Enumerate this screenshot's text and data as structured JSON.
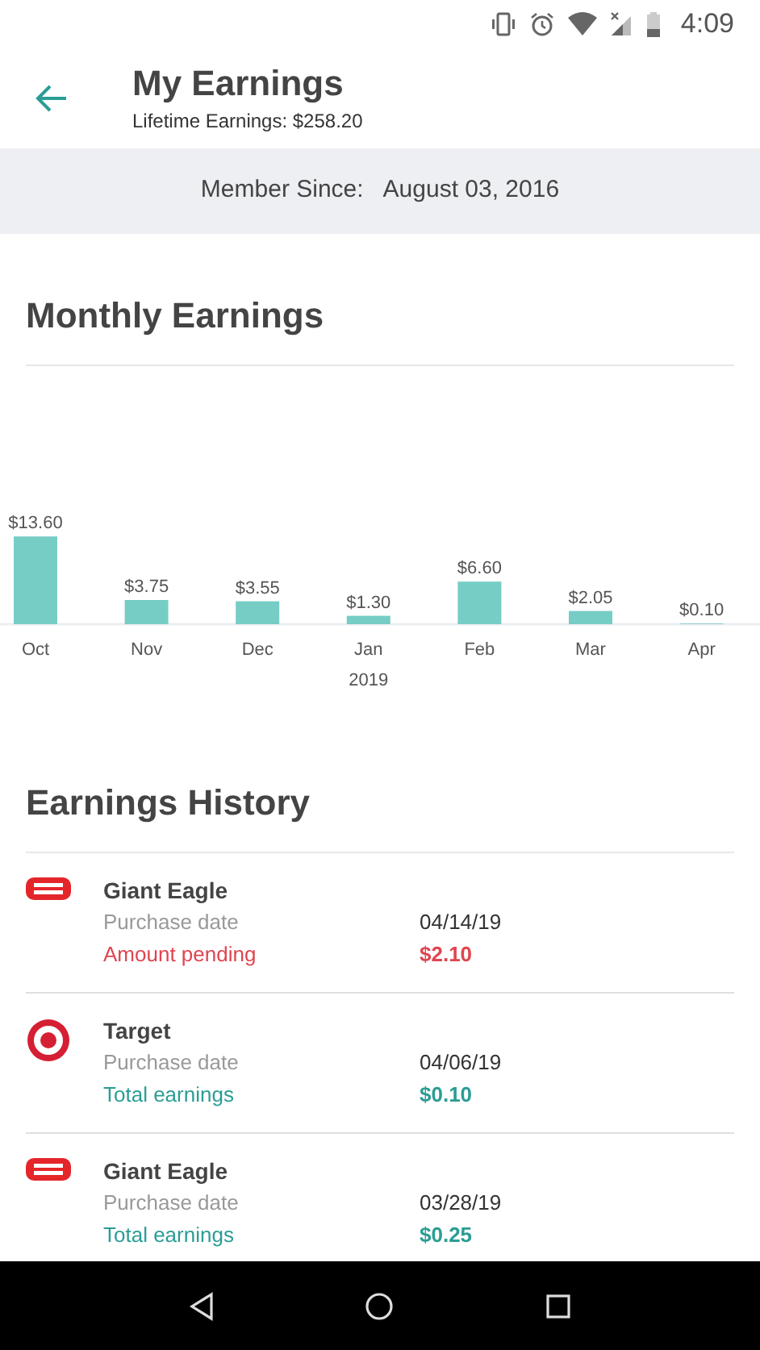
{
  "status_bar": {
    "time": "4:09"
  },
  "header": {
    "title": "My Earnings",
    "subtitle": "Lifetime Earnings: $258.20"
  },
  "member_since": {
    "label": "Member Since:",
    "value": "August 03, 2016"
  },
  "monthly": {
    "title": "Monthly Earnings",
    "chart_data": {
      "type": "bar",
      "categories": [
        "Oct",
        "Nov",
        "Dec",
        "Jan",
        "Feb",
        "Mar",
        "Apr"
      ],
      "values": [
        13.6,
        3.75,
        3.55,
        1.3,
        6.6,
        2.05,
        0.1
      ],
      "value_labels": [
        "$13.60",
        "$3.75",
        "$3.55",
        "$1.30",
        "$6.60",
        "$2.05",
        "$0.10"
      ],
      "annotations": [
        "2019"
      ]
    }
  },
  "history": {
    "title": "Earnings History",
    "items": [
      {
        "store": "Giant Eagle",
        "kind": "eagle",
        "date_label": "Purchase date",
        "date": "04/14/19",
        "pending": true,
        "amount_label": "Amount pending",
        "amount": "$2.10"
      },
      {
        "store": "Target",
        "kind": "bullseye",
        "date_label": "Purchase date",
        "date": "04/06/19",
        "pending": false,
        "amount_label": "Total earnings",
        "amount": "$0.10"
      },
      {
        "store": "Giant Eagle",
        "kind": "eagle",
        "date_label": "Purchase date",
        "date": "03/28/19",
        "pending": false,
        "amount_label": "Total earnings",
        "amount": "$0.25"
      }
    ]
  }
}
